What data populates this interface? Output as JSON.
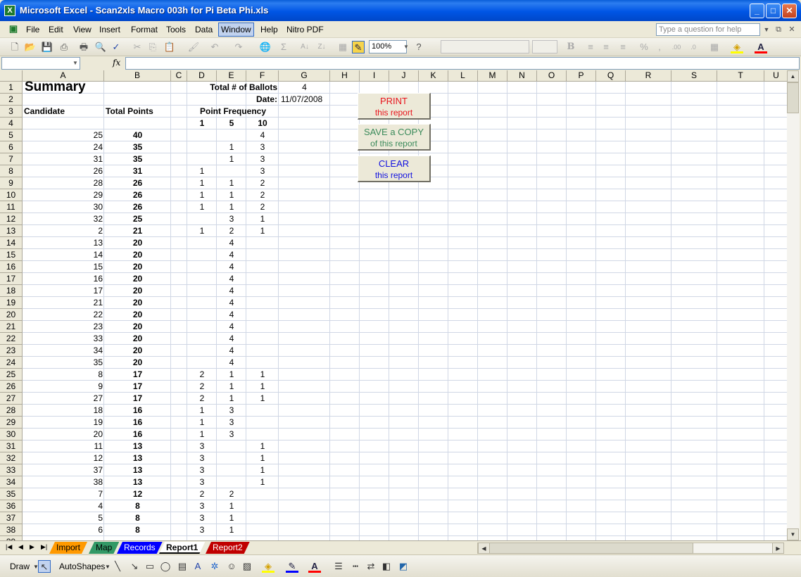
{
  "window": {
    "title": "Microsoft Excel - Scan2xls Macro 003h for Pi Beta Phi.xls"
  },
  "menu": [
    "File",
    "Edit",
    "View",
    "Insert",
    "Format",
    "Tools",
    "Data",
    "Window",
    "Help",
    "Nitro PDF"
  ],
  "ask_placeholder": "Type a question for help",
  "toolbar": {
    "zoom": "100%"
  },
  "formula": {
    "fx": "fx",
    "name_box": ""
  },
  "columns": [
    "A",
    "B",
    "C",
    "D",
    "E",
    "F",
    "G",
    "H",
    "I",
    "J",
    "K",
    "L",
    "M",
    "N",
    "O",
    "P",
    "Q",
    "R",
    "S",
    "T",
    "U"
  ],
  "sheet": {
    "title": "Summary",
    "ballots_label": "Total # of Ballots",
    "ballots_value": "4",
    "date_label": "Date:",
    "date_value": "11/07/2008",
    "candidate_header": "Candidate",
    "total_header": "Total Points",
    "freq_header": "Point Frequency",
    "freq_cols": [
      "1",
      "5",
      "10"
    ],
    "rows": [
      [
        "25",
        "40",
        "",
        "",
        "4"
      ],
      [
        "24",
        "35",
        "",
        "1",
        "3"
      ],
      [
        "31",
        "35",
        "",
        "1",
        "3"
      ],
      [
        "26",
        "31",
        "1",
        "",
        "3"
      ],
      [
        "28",
        "26",
        "1",
        "1",
        "2"
      ],
      [
        "29",
        "26",
        "1",
        "1",
        "2"
      ],
      [
        "30",
        "26",
        "1",
        "1",
        "2"
      ],
      [
        "32",
        "25",
        "",
        "3",
        "1"
      ],
      [
        "2",
        "21",
        "1",
        "2",
        "1"
      ],
      [
        "13",
        "20",
        "",
        "4",
        ""
      ],
      [
        "14",
        "20",
        "",
        "4",
        ""
      ],
      [
        "15",
        "20",
        "",
        "4",
        ""
      ],
      [
        "16",
        "20",
        "",
        "4",
        ""
      ],
      [
        "17",
        "20",
        "",
        "4",
        ""
      ],
      [
        "21",
        "20",
        "",
        "4",
        ""
      ],
      [
        "22",
        "20",
        "",
        "4",
        ""
      ],
      [
        "23",
        "20",
        "",
        "4",
        ""
      ],
      [
        "33",
        "20",
        "",
        "4",
        ""
      ],
      [
        "34",
        "20",
        "",
        "4",
        ""
      ],
      [
        "35",
        "20",
        "",
        "4",
        ""
      ],
      [
        "8",
        "17",
        "2",
        "1",
        "1"
      ],
      [
        "9",
        "17",
        "2",
        "1",
        "1"
      ],
      [
        "27",
        "17",
        "2",
        "1",
        "1"
      ],
      [
        "18",
        "16",
        "1",
        "3",
        ""
      ],
      [
        "19",
        "16",
        "1",
        "3",
        ""
      ],
      [
        "20",
        "16",
        "1",
        "3",
        ""
      ],
      [
        "11",
        "13",
        "3",
        "",
        "1"
      ],
      [
        "12",
        "13",
        "3",
        "",
        "1"
      ],
      [
        "37",
        "13",
        "3",
        "",
        "1"
      ],
      [
        "38",
        "13",
        "3",
        "",
        "1"
      ],
      [
        "7",
        "12",
        "2",
        "2",
        ""
      ],
      [
        "4",
        "8",
        "3",
        "1",
        ""
      ],
      [
        "5",
        "8",
        "3",
        "1",
        ""
      ],
      [
        "6",
        "8",
        "3",
        "1",
        ""
      ]
    ]
  },
  "buttons": [
    {
      "line1": "PRINT",
      "line2": "this report",
      "color": "#e8141c"
    },
    {
      "line1": "SAVE a COPY",
      "line2": "of this report",
      "color": "#3a8a5a"
    },
    {
      "line1": "CLEAR",
      "line2": "this report",
      "color": "#1010e0"
    }
  ],
  "tabs": [
    {
      "label": "Import",
      "color": "#ff9900"
    },
    {
      "label": "Map",
      "color": "#339966"
    },
    {
      "label": "Records",
      "color": "#0000ff"
    },
    {
      "label": "Report1",
      "color": "#ffffff"
    },
    {
      "label": "Report2",
      "color": "#c00000"
    }
  ],
  "drawbar": {
    "draw": "Draw",
    "autoshapes": "AutoShapes"
  }
}
